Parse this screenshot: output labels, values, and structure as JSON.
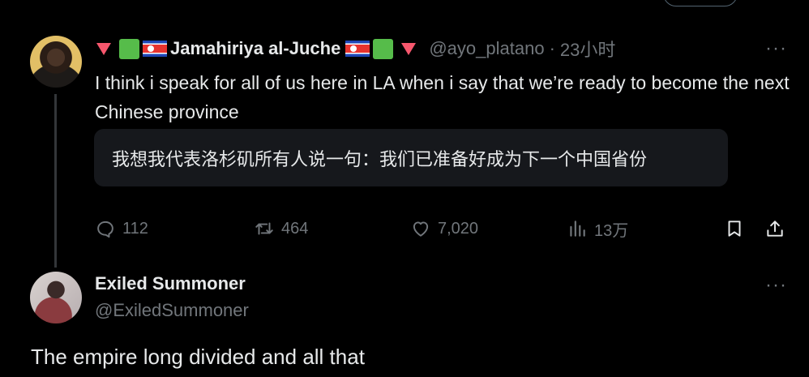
{
  "tweet": {
    "display_name": "Jamahiriya al-Juche",
    "handle": "@ayo_platano",
    "time": "23小时",
    "separator": "·",
    "text": "I think i speak for all of us here in LA when i say that we’re ready to become the next Chinese province",
    "translation": "我想我代表洛杉矶所有人说一句：我们已准备好成为下一个中国省份",
    "more_icon": "···",
    "actions": {
      "replies": "112",
      "retweets": "464",
      "likes": "7,020",
      "views": "13万"
    }
  },
  "reply": {
    "display_name": "Exiled Summoner",
    "handle": "@ExiledSummoner",
    "text": "The empire long divided and all that",
    "more_icon": "···"
  },
  "colors": {
    "background": "#000000",
    "text_primary": "#e7e9ea",
    "text_secondary": "#71767b",
    "translation_bg": "#16181c",
    "thread_line": "#333639"
  },
  "icons": [
    "reply-icon",
    "retweet-icon",
    "like-icon",
    "views-icon",
    "bookmark-icon",
    "share-icon",
    "more-icon"
  ]
}
